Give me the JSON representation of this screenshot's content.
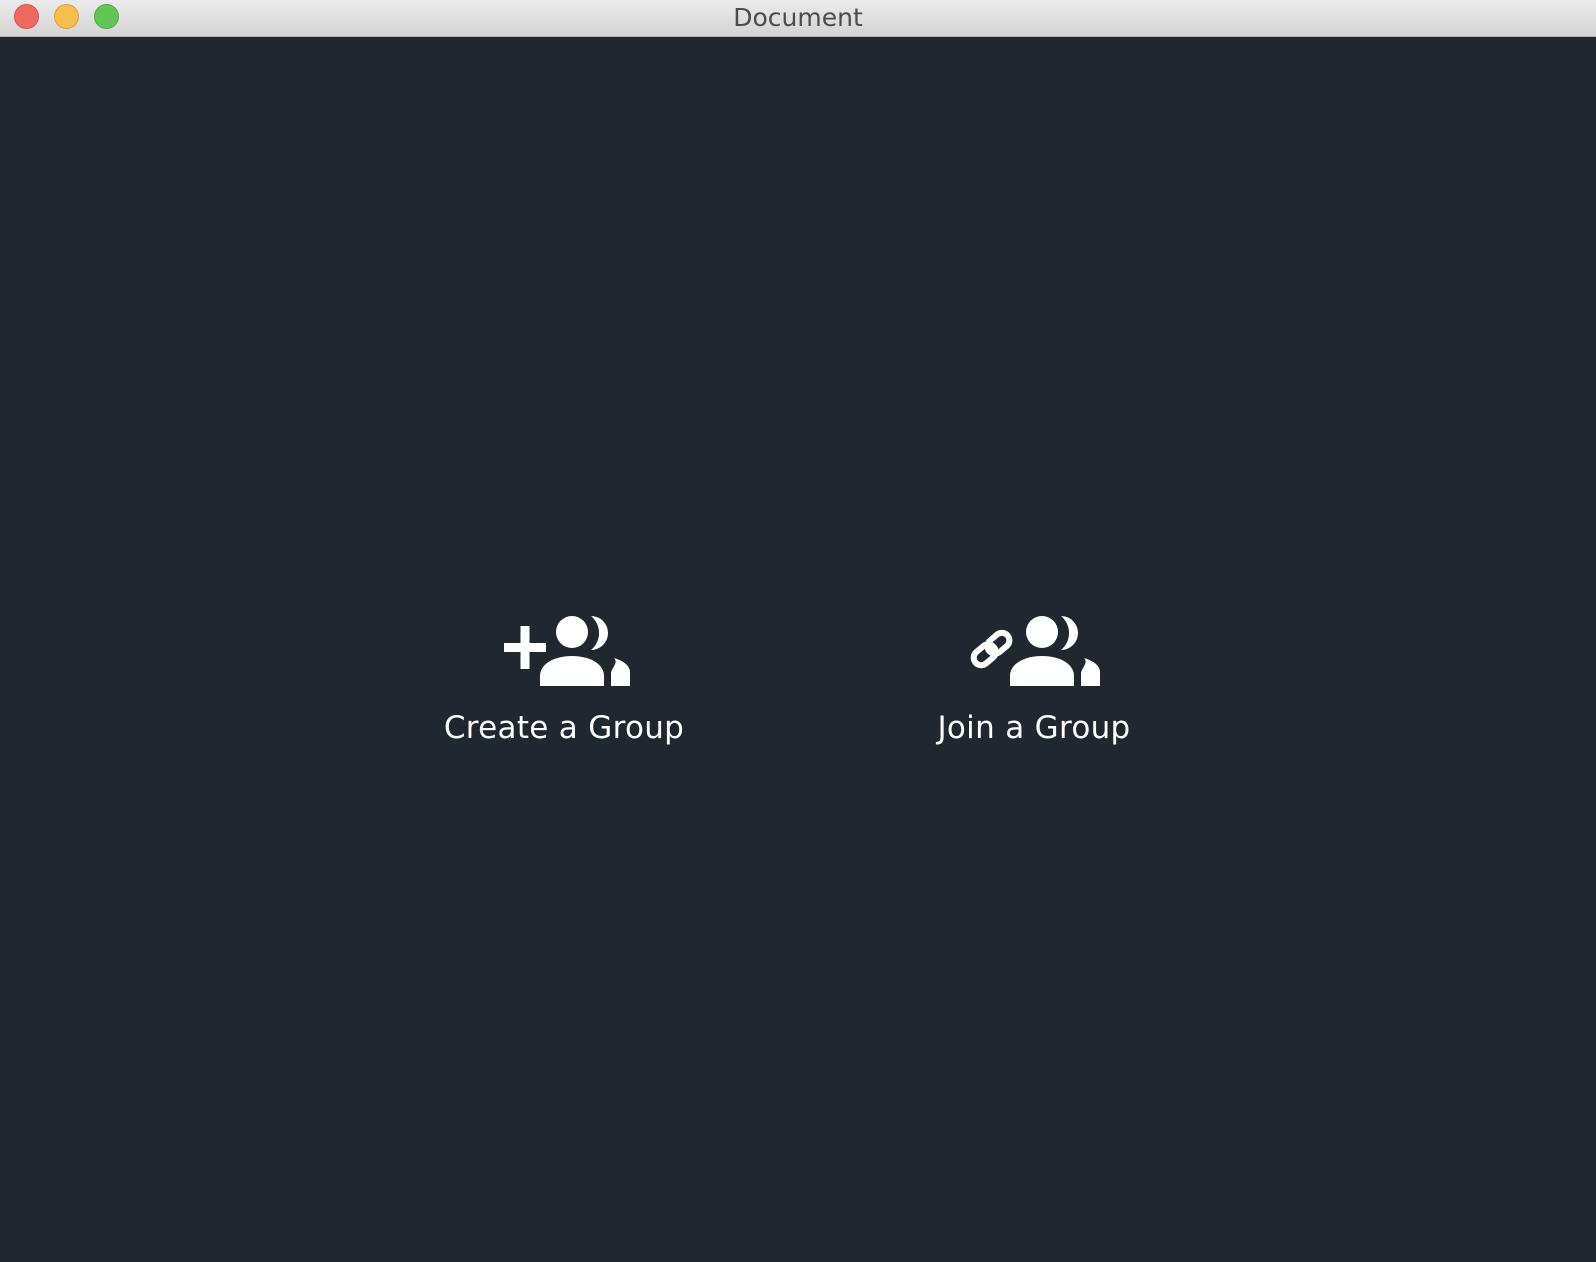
{
  "window": {
    "title": "Document"
  },
  "actions": {
    "create": {
      "label": "Create a Group",
      "icon": "add-group-icon"
    },
    "join": {
      "label": "Join a Group",
      "icon": "link-group-icon"
    }
  },
  "colors": {
    "background": "#21272f",
    "text": "#ffffff"
  }
}
